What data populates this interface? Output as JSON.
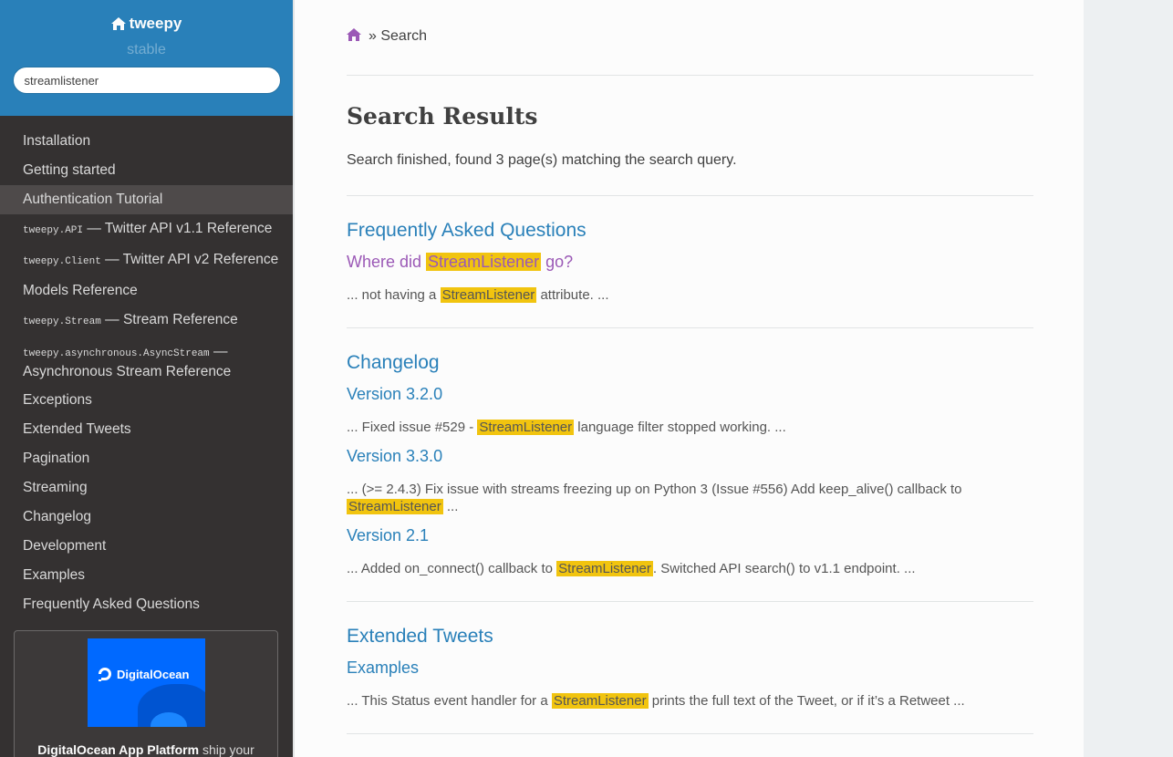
{
  "sidebar": {
    "project_name": "tweepy",
    "version": "stable",
    "search_value": "streamlistener",
    "nav": [
      {
        "label": "Installation"
      },
      {
        "label": "Getting started"
      },
      {
        "label": "Authentication Tutorial",
        "current": true
      },
      {
        "code": "tweepy.API",
        "label": " — Twitter API v1.1 Reference"
      },
      {
        "code": "tweepy.Client",
        "label": " — Twitter API v2 Reference"
      },
      {
        "label": "Models Reference"
      },
      {
        "code": "tweepy.Stream",
        "label": " — Stream Reference"
      },
      {
        "code": "tweepy.asynchronous.AsyncStream",
        "label": " —",
        "label2": "Asynchronous Stream Reference"
      },
      {
        "label": "Exceptions"
      },
      {
        "label": "Extended Tweets"
      },
      {
        "label": "Pagination"
      },
      {
        "label": "Streaming"
      },
      {
        "label": "Changelog"
      },
      {
        "label": "Development"
      },
      {
        "label": "Examples"
      },
      {
        "label": "Frequently Asked Questions"
      }
    ],
    "ad": {
      "logo_text": "DigitalOcean",
      "text_bold": "DigitalOcean App Platform",
      "text_rest": " ship your"
    }
  },
  "breadcrumb": {
    "separator": "»",
    "current": "Search"
  },
  "main": {
    "title": "Search Results",
    "summary": "Search finished, found 3 page(s) matching the search query.",
    "results": [
      {
        "page": "Frequently Asked Questions",
        "sections": [
          {
            "title_before": "Where did ",
            "title_hl": "StreamListener",
            "title_after": " go?",
            "visited": true,
            "snippet_before": "... not having a ",
            "snippet_hl": "StreamListener",
            "snippet_after": " attribute. ..."
          }
        ]
      },
      {
        "page": "Changelog",
        "sections": [
          {
            "title": "Version 3.2.0",
            "snippet_before": "... Fixed issue #529 - ",
            "snippet_hl": "StreamListener",
            "snippet_after": " language filter stopped working. ..."
          },
          {
            "title": "Version 3.3.0",
            "snippet_before": "... (>= 2.4.3) Fix issue with streams freezing up on Python 3 (Issue #556) Add keep_alive() callback to ",
            "snippet_hl": "StreamListener",
            "snippet_after": " ..."
          },
          {
            "title": "Version 2.1",
            "snippet_before": "... Added on_connect() callback to ",
            "snippet_hl": "StreamListener",
            "snippet_after": ". Switched API search() to v1.1 endpoint. ..."
          }
        ]
      },
      {
        "page": "Extended Tweets",
        "sections": [
          {
            "title": "Examples",
            "snippet_before": "... This Status event handler for a ",
            "snippet_hl": "StreamListener",
            "snippet_after": " prints the full text of the Tweet, or if it’s a Retweet ..."
          }
        ]
      }
    ]
  },
  "colors": {
    "link": "#2980b9",
    "visited": "#9b59b6",
    "highlight": "#f1c40f",
    "sidebar_bg": "#343131",
    "sidebar_top": "#2980b9"
  }
}
